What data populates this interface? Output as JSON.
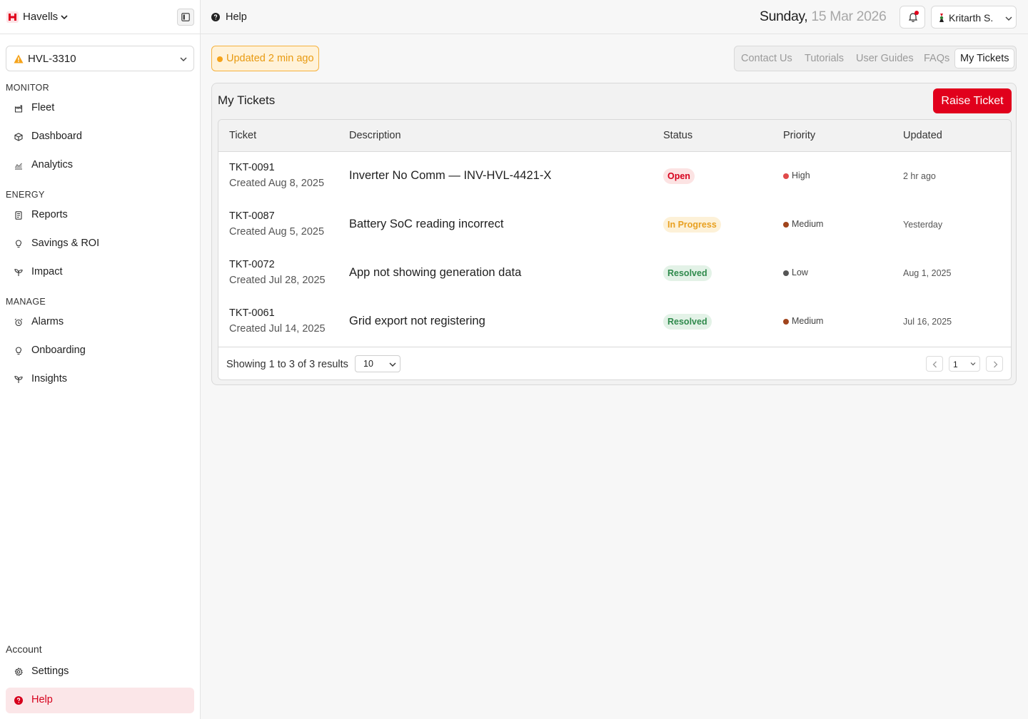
{
  "brand": {
    "name": "Havells",
    "icon": "havells-logo",
    "color": "#e1001c"
  },
  "site": {
    "name": "HVL-3310",
    "status_icon": "warning-triangle-icon"
  },
  "sidebar": {
    "sections": [
      {
        "label": "MONITOR",
        "items": [
          {
            "label": "Fleet",
            "icon": "fleet-icon"
          },
          {
            "label": "Dashboard",
            "icon": "cube-icon"
          },
          {
            "label": "Analytics",
            "icon": "analytics-icon"
          }
        ]
      },
      {
        "label": "ENERGY",
        "items": [
          {
            "label": "Reports",
            "icon": "document-icon"
          },
          {
            "label": "Savings & ROI",
            "icon": "bulb-icon"
          },
          {
            "label": "Impact",
            "icon": "sprout-icon"
          }
        ]
      },
      {
        "label": "MANAGE",
        "items": [
          {
            "label": "Alarms",
            "icon": "alarm-icon"
          },
          {
            "label": "Onboarding",
            "icon": "bulb-icon"
          },
          {
            "label": "Insights",
            "icon": "sprout-icon"
          }
        ]
      }
    ],
    "account": {
      "label": "Account",
      "items": [
        {
          "label": "Settings",
          "icon": "gear-icon"
        },
        {
          "label": "Help",
          "icon": "help-icon",
          "active": true
        }
      ]
    }
  },
  "topbar": {
    "page": "Help",
    "date_day": "Sunday,",
    "date_rest": " 15 Mar 2026",
    "user": "Kritarth S."
  },
  "status": {
    "updated": "Updated 2 min ago"
  },
  "tabs": [
    "Contact Us",
    "Tutorials",
    "User Guides",
    "FAQs",
    "My Tickets"
  ],
  "active_tab": "My Tickets",
  "tickets": {
    "title": "My Tickets",
    "raise_label": "Raise Ticket",
    "columns": [
      "Ticket",
      "Description",
      "Status",
      "Priority",
      "Updated"
    ],
    "rows": [
      {
        "id": "TKT-0091",
        "created": "Created Aug 8, 2025",
        "description": "Inverter No Comm — INV-HVL-4421-X",
        "status": "Open",
        "status_kind": "open",
        "priority": "High",
        "priority_color": "#e04a4a",
        "updated": "2 hr ago"
      },
      {
        "id": "TKT-0087",
        "created": "Created Aug 5, 2025",
        "description": "Battery SoC reading incorrect",
        "status": "In Progress",
        "status_kind": "progress",
        "priority": "Medium",
        "priority_color": "#a0441c",
        "updated": "Yesterday"
      },
      {
        "id": "TKT-0072",
        "created": "Created Jul 28, 2025",
        "description": "App not showing generation data",
        "status": "Resolved",
        "status_kind": "resolved",
        "priority": "Low",
        "priority_color": "#555555",
        "updated": "Aug 1, 2025"
      },
      {
        "id": "TKT-0061",
        "created": "Created Jul 14, 2025",
        "description": "Grid export not registering",
        "status": "Resolved",
        "status_kind": "resolved",
        "priority": "Medium",
        "priority_color": "#a0441c",
        "updated": "Jul 16, 2025"
      }
    ],
    "footer": {
      "showing": "Showing 1 to 3  of 3 results",
      "page_size": "10",
      "page": "1"
    }
  }
}
